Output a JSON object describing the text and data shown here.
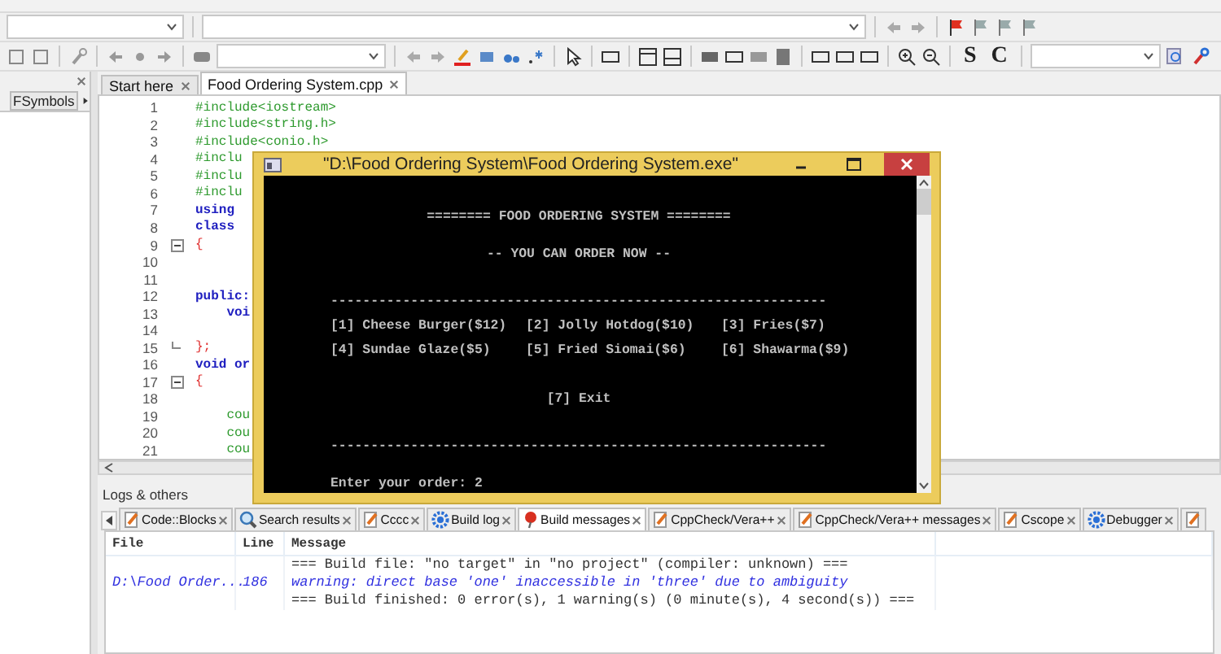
{
  "toolbar": {
    "letters": [
      "S",
      "C"
    ]
  },
  "left_panel": {
    "tab": "FSymbols"
  },
  "editor": {
    "tabs": [
      {
        "label": "Start here",
        "selected": false
      },
      {
        "label": "Food Ordering System.cpp",
        "selected": true
      }
    ],
    "lines": [
      {
        "number": "1",
        "text": "#include<iostream>",
        "kind": "directive"
      },
      {
        "number": "2",
        "text": "#include<string.h>",
        "kind": "directive"
      },
      {
        "number": "3",
        "text": "#include<conio.h>",
        "kind": "directive"
      },
      {
        "number": "4",
        "text": "#inclu",
        "kind": "directive"
      },
      {
        "number": "5",
        "text": "#inclu",
        "kind": "directive"
      },
      {
        "number": "6",
        "text": "#inclu",
        "kind": "directive"
      },
      {
        "number": "7",
        "text": "using",
        "kind": "keyword"
      },
      {
        "number": "8",
        "text": "class",
        "kind": "keyword"
      },
      {
        "number": "9",
        "text": "{",
        "kind": "brace",
        "fold_start": true
      },
      {
        "number": "10"
      },
      {
        "number": "11"
      },
      {
        "number": "12",
        "text": "public:",
        "kind": "keyword"
      },
      {
        "number": "13",
        "text": "    voi",
        "kind": "keyword"
      },
      {
        "number": "14"
      },
      {
        "number": "15",
        "text": "};",
        "kind": "brace",
        "fold_end": true
      },
      {
        "number": "16",
        "text": "void or",
        "kind": "keyword"
      },
      {
        "number": "17",
        "text": "{",
        "kind": "brace",
        "fold_start": true
      },
      {
        "number": "18"
      },
      {
        "number": "19",
        "text": "    cou",
        "kind": "directive"
      },
      {
        "number": "20",
        "text": "    cou",
        "kind": "directive"
      },
      {
        "number": "21",
        "text": "    cou",
        "kind": "directive"
      }
    ]
  },
  "console": {
    "title": "\"D:\\Food Ordering System\\Food Ordering System.exe\"",
    "lines": [
      {
        "kind": "heading",
        "text": "======== FOOD ORDERING SYSTEM ========"
      },
      {
        "kind": "heading",
        "text": "-- YOU CAN ORDER NOW --"
      },
      {
        "kind": "rule",
        "text": "--------------------------------------------------------------"
      },
      {
        "kind": "menu",
        "cells": [
          "[1] Cheese Burger($12)",
          "[2] Jolly Hotdog($10)",
          "[3] Fries($7)"
        ]
      },
      {
        "kind": "menu",
        "cells": [
          "[4] Sundae Glaze($5)",
          "[5] Fried Siomai($6)",
          "[6] Shawarma($9)"
        ]
      },
      {
        "kind": "centered",
        "text": "[7] Exit"
      },
      {
        "kind": "rule",
        "text": "--------------------------------------------------------------"
      },
      {
        "kind": "prompt",
        "text": "Enter your order: 2"
      }
    ]
  },
  "logs": {
    "title": "Logs & others",
    "tabs": [
      {
        "label": "Code::Blocks",
        "kind": "pencil",
        "selected": false
      },
      {
        "label": "Search results",
        "kind": "search",
        "selected": false
      },
      {
        "label": "Cccc",
        "kind": "pencil",
        "selected": false
      },
      {
        "label": "Build log",
        "kind": "gear",
        "selected": false
      },
      {
        "label": "Build messages",
        "kind": "pin",
        "selected": true
      },
      {
        "label": "CppCheck/Vera++",
        "kind": "pencil",
        "selected": false
      },
      {
        "label": "CppCheck/Vera++ messages",
        "kind": "pencil",
        "selected": false
      },
      {
        "label": "Cscope",
        "kind": "pencil",
        "selected": false
      },
      {
        "label": "Debugger",
        "kind": "gear",
        "selected": false
      },
      {
        "kind": "pencil",
        "selected": false
      }
    ],
    "columns": [
      "File",
      "Line",
      "Message"
    ],
    "rows": [
      {
        "kind": "info",
        "message": "=== Build file: \"no target\" in \"no project\" (compiler: unknown) ==="
      },
      {
        "kind": "warning",
        "file": "D:\\Food Order...",
        "line": "186",
        "message": "warning: direct base 'one' inaccessible in 'three' due to ambiguity"
      },
      {
        "kind": "info",
        "message": "=== Build finished: 0 error(s), 1 warning(s) (0 minute(s), 4 second(s)) ==="
      }
    ]
  }
}
